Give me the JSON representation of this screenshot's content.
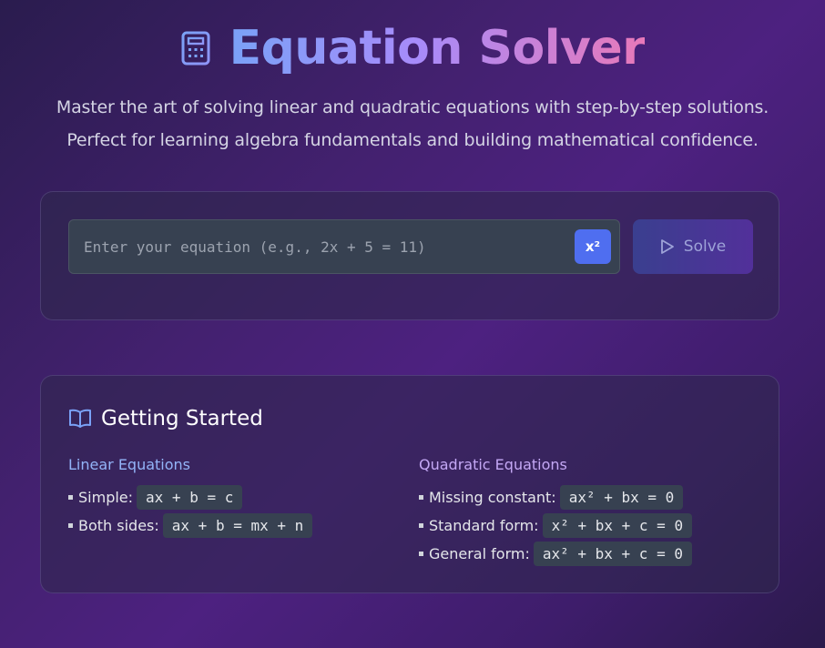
{
  "header": {
    "title": "Equation Solver",
    "icon": "calculator-icon",
    "subtitle_line1": "Master the art of solving linear and quadratic equations with step-by-step solutions.",
    "subtitle_line2": "Perfect for learning algebra fundamentals and building mathematical confidence."
  },
  "input": {
    "placeholder": "Enter your equation (e.g., 2x + 5 = 11)",
    "value": "",
    "square_button_label": "x²",
    "solve_button_label": "Solve",
    "solve_icon": "play-icon"
  },
  "guide": {
    "title": "Getting Started",
    "icon": "book-icon",
    "linear": {
      "title": "Linear Equations",
      "items": [
        {
          "label": "Simple:",
          "example": "ax + b = c"
        },
        {
          "label": "Both sides:",
          "example": "ax + b = mx + n"
        }
      ]
    },
    "quadratic": {
      "title": "Quadratic Equations",
      "items": [
        {
          "label": "Missing constant:",
          "example": "ax² + bx = 0"
        },
        {
          "label": "Standard form:",
          "example": "x² + bx + c = 0"
        },
        {
          "label": "General form:",
          "example": "ax² + bx + c = 0"
        }
      ]
    }
  },
  "colors": {
    "accent_blue": "#4f6ef0",
    "title_gradient_start": "#7aa2f7",
    "title_gradient_end": "#e879b9"
  }
}
